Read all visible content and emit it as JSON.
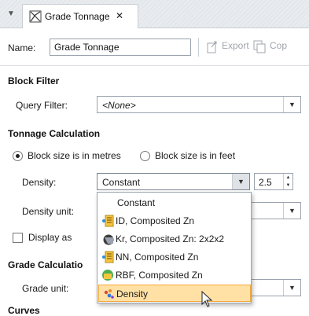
{
  "tab": {
    "menu_glyph": "▼",
    "icon": "grade-tonnage-icon",
    "label": "Grade Tonnage",
    "close_glyph": "✕"
  },
  "toolbar": {
    "name_label": "Name:",
    "name_value": "Grade Tonnage",
    "export_label": "Export",
    "copy_label": "Cop"
  },
  "block_filter": {
    "title": "Block Filter",
    "query_label": "Query Filter:",
    "query_value": "<None>"
  },
  "tonnage": {
    "title": "Tonnage Calculation",
    "radio_metres": "Block size is in metres",
    "radio_feet": "Block size is in feet",
    "selected_radio": "metres",
    "density_label": "Density:",
    "density_value": "Constant",
    "density_number": "2.5",
    "density_unit_label": "Density unit:",
    "display_as_label": "Display as",
    "display_as_checked": false
  },
  "grade": {
    "title": "Grade Calculatio",
    "unit_label": "Grade unit:"
  },
  "curves": {
    "title": "Curves"
  },
  "dropdown": {
    "options": [
      {
        "label": "Constant",
        "icon": ""
      },
      {
        "label": "ID, Composited Zn",
        "icon": "id-estimator-icon"
      },
      {
        "label": "Kr, Composited Zn: 2x2x2",
        "icon": "kriging-estimator-icon"
      },
      {
        "label": "NN, Composited Zn",
        "icon": "nn-estimator-icon"
      },
      {
        "label": "RBF, Composited Zn",
        "icon": "rbf-estimator-icon"
      },
      {
        "label": "Density",
        "icon": "density-icon"
      }
    ],
    "selected_index": 5
  },
  "colors": {
    "selection_bg": "#ffe1a6",
    "selection_border": "#f2a93b"
  }
}
